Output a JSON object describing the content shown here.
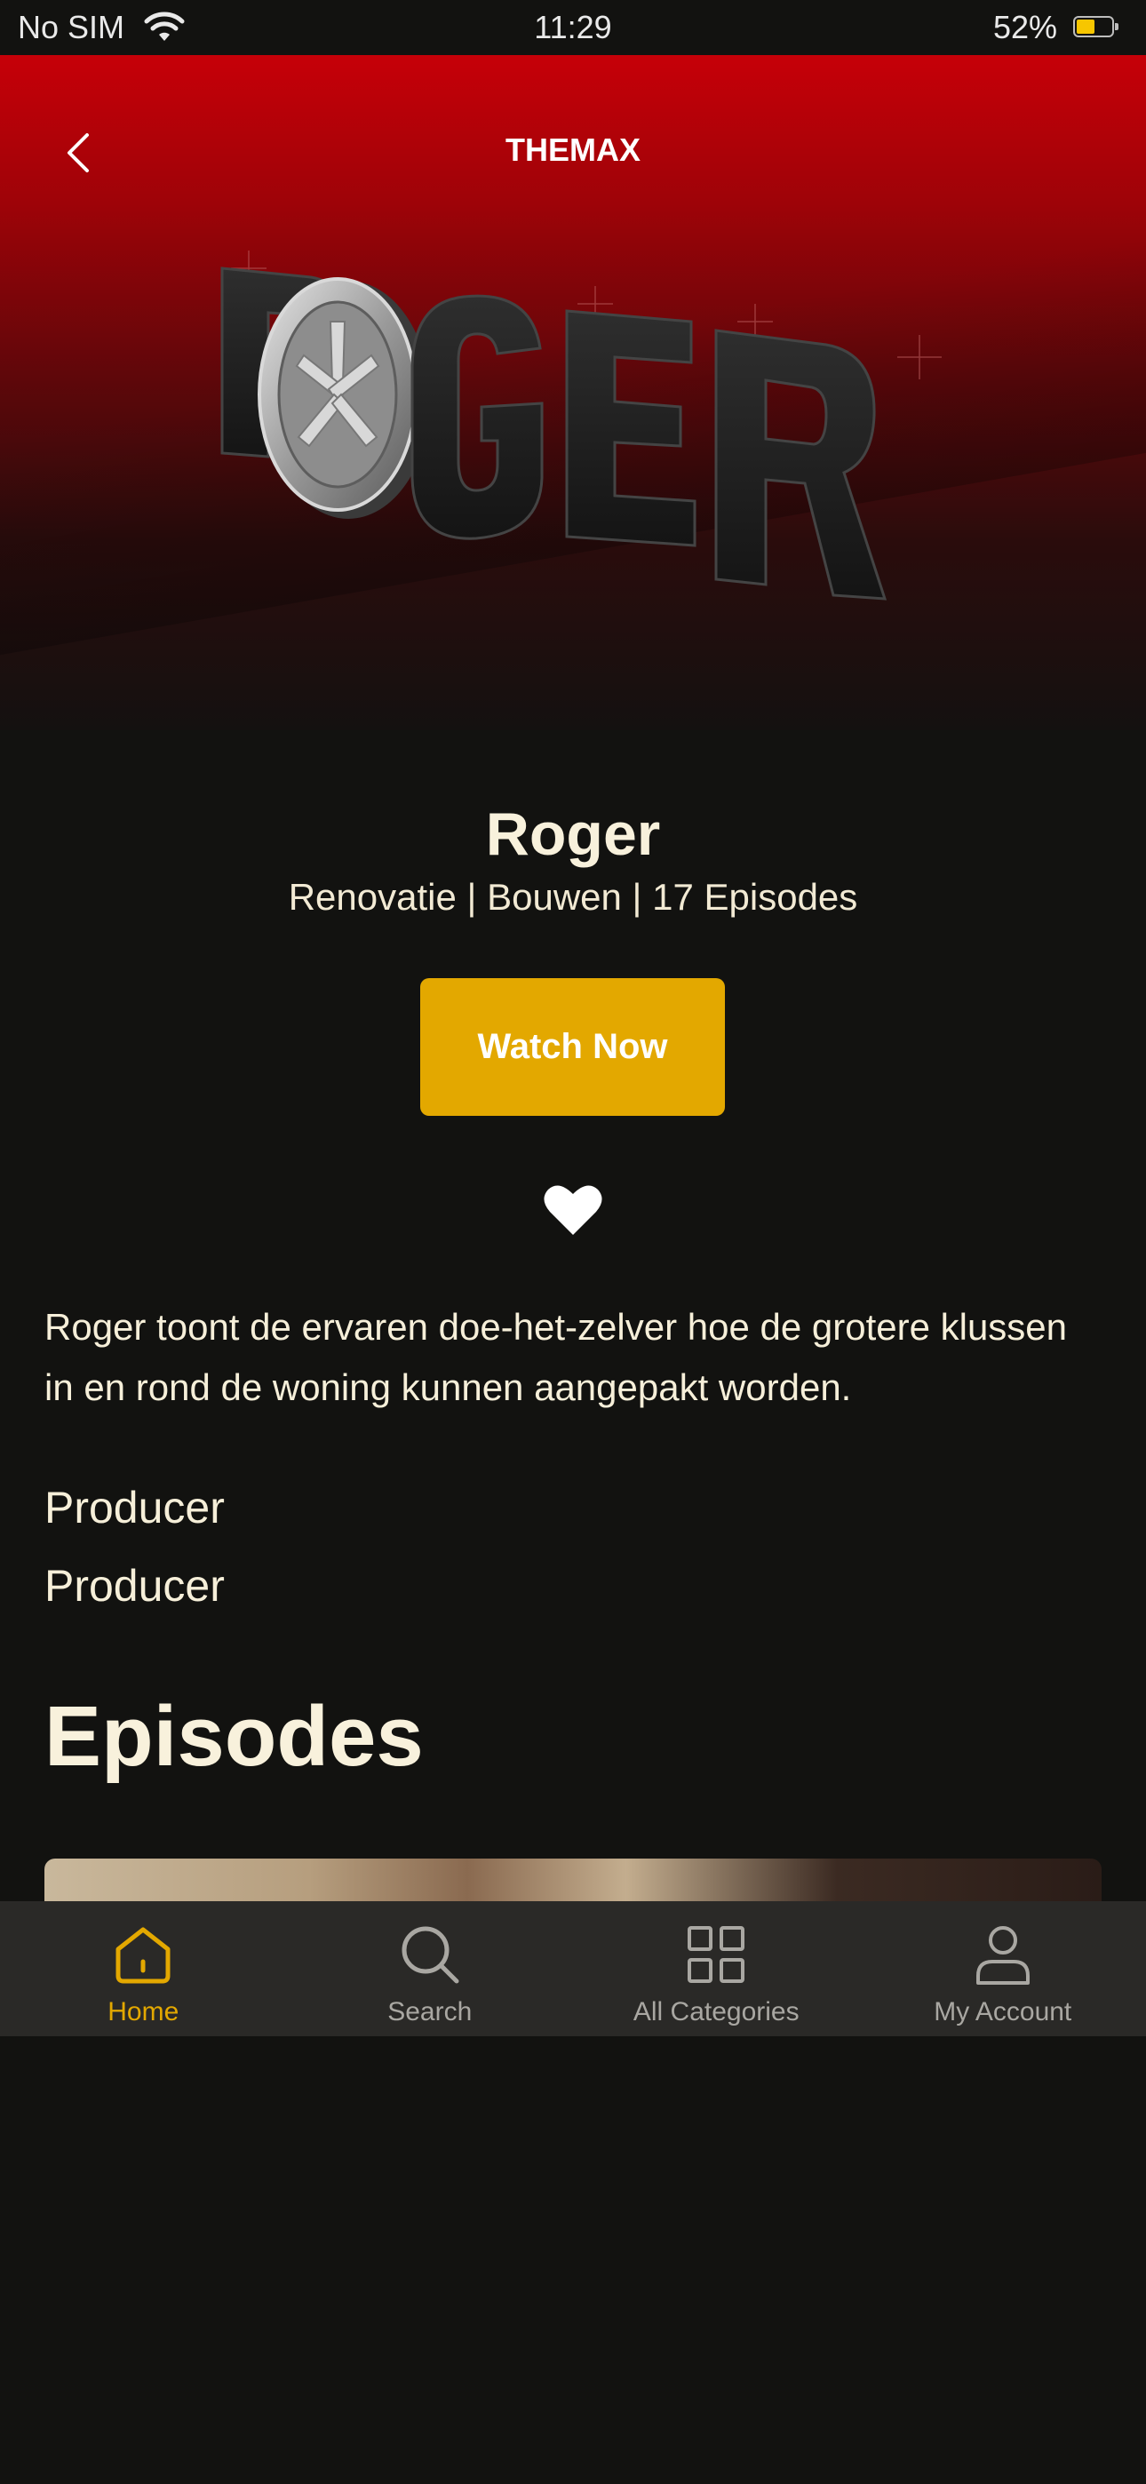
{
  "status_bar": {
    "carrier": "No SIM",
    "time": "11:29",
    "battery_percent": "52%",
    "battery_level": 0.52,
    "battery_color": "#f7c600"
  },
  "header": {
    "back_icon": "chevron-left-icon",
    "brand": "THEMAX"
  },
  "hero": {
    "logo_text": "ROGER",
    "colors": {
      "top": "#c60008",
      "bottom": "#141110"
    }
  },
  "show": {
    "title": "Roger",
    "meta": "Renovatie | Bouwen | 17 Episodes",
    "watch_label": "Watch Now",
    "favorite_icon": "heart-icon",
    "description": "Roger toont de ervaren doe-het-zelver hoe de grotere klussen in en rond de woning kunnen aangepakt worden.",
    "credits": [
      "Producer",
      "Producer"
    ]
  },
  "episodes": {
    "heading": "Episodes"
  },
  "tab_bar": {
    "active_color": "#e3a800",
    "tabs": [
      {
        "label": "Home",
        "icon": "home-icon",
        "active": true
      },
      {
        "label": "Search",
        "icon": "search-icon",
        "active": false
      },
      {
        "label": "All Categories",
        "icon": "grid-icon",
        "active": false
      },
      {
        "label": "My Account",
        "icon": "user-icon",
        "active": false
      }
    ]
  }
}
